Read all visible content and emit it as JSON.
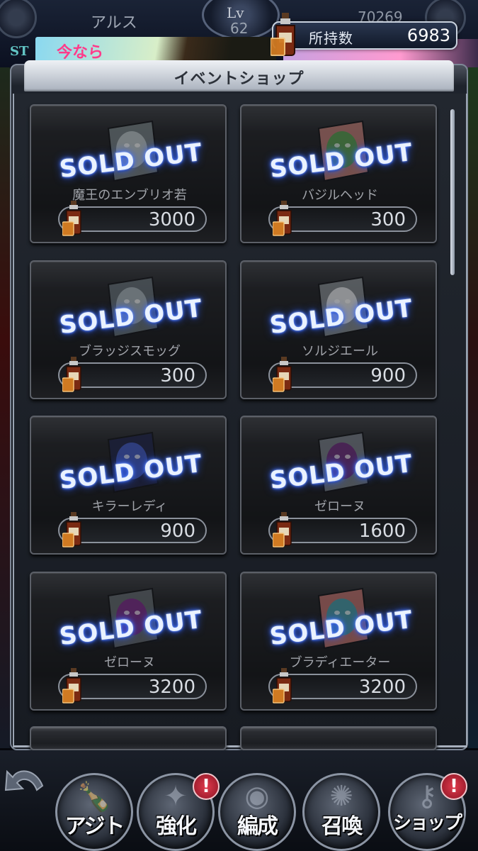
{
  "header": {
    "player_name": "アルス",
    "level_label": "Lv",
    "level_value": "62",
    "gold": "70269",
    "stage_tag": "ST",
    "banner_text": "今なら"
  },
  "currency": {
    "label": "所持数",
    "value": "6983",
    "icon": "whiskey-bottle-icon"
  },
  "shop": {
    "title": "イベントショップ",
    "sold_out_label": "SOLD OUT",
    "items": [
      {
        "name": "魔王のエンブリオ若",
        "price": "3000",
        "sold_out": true
      },
      {
        "name": "バジルヘッド",
        "price": "300",
        "sold_out": true
      },
      {
        "name": "ブラッジスモッグ",
        "price": "300",
        "sold_out": true
      },
      {
        "name": "ソルジエール",
        "price": "900",
        "sold_out": true
      },
      {
        "name": "キラーレディ",
        "price": "900",
        "sold_out": true
      },
      {
        "name": "ゼローヌ",
        "price": "1600",
        "sold_out": true
      },
      {
        "name": "ゼローヌ",
        "price": "3200",
        "sold_out": true
      },
      {
        "name": "ブラディエーター",
        "price": "3200",
        "sold_out": true
      }
    ]
  },
  "nav": {
    "items": [
      {
        "label": "アジト",
        "icon": "bottle-icon",
        "badge": false
      },
      {
        "label": "強化",
        "icon": "power-icon",
        "badge": true
      },
      {
        "label": "編成",
        "icon": "team-icon",
        "badge": false
      },
      {
        "label": "召喚",
        "icon": "summon-circle-icon",
        "badge": false
      },
      {
        "label": "ショップ",
        "icon": "shop-key-icon",
        "badge": true
      }
    ],
    "badge_text": "!"
  },
  "colors": {
    "sold_out_glow": "#2a5cff",
    "badge_red": "#e03a4c",
    "panel_frame": "#9aa4b2"
  }
}
